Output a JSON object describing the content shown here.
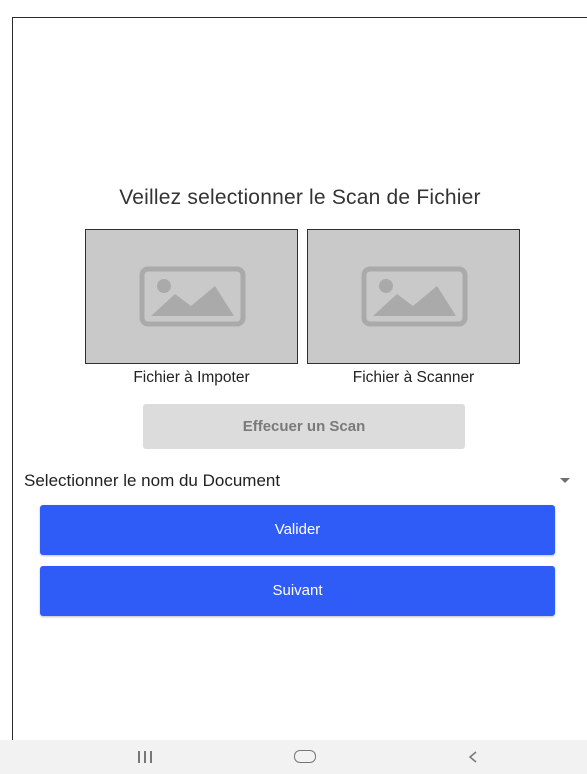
{
  "page": {
    "title": "Veillez selectionner le Scan de Fichier"
  },
  "tiles": {
    "import_label": "Fichier à Impoter",
    "scan_label": "Fichier à Scanner",
    "placeholder_icon": "image-placeholder-icon"
  },
  "scan_button": {
    "label": "Effecuer un Scan"
  },
  "document_select": {
    "selected": "Selectionner le nom du Document"
  },
  "actions": {
    "valider_label": "Valider",
    "suivant_label": "Suivant"
  },
  "navbar": {
    "icons": [
      "recent-apps-icon",
      "home-icon",
      "back-icon"
    ]
  },
  "colors": {
    "primary": "#2f5cf6",
    "disabled_button": "#dcdcdc",
    "tile_background": "#c9c9c9",
    "navbar_background": "#f2f2f2"
  }
}
